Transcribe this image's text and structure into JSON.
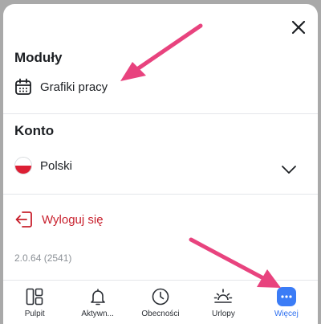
{
  "modules": {
    "title": "Moduły",
    "items": [
      {
        "label": "Grafiki pracy",
        "icon": "calendar-icon"
      }
    ]
  },
  "account": {
    "title": "Konto",
    "language": {
      "label": "Polski",
      "icon": "poland-flag-icon"
    }
  },
  "logout": {
    "label": "Wyloguj się",
    "icon": "logout-icon",
    "color": "#c8202d"
  },
  "version": "2.0.64 (2541)",
  "bottom_nav": {
    "items": [
      {
        "label": "Pulpit",
        "icon": "dashboard-icon",
        "active": false
      },
      {
        "label": "Aktywn...",
        "icon": "bell-icon",
        "active": false
      },
      {
        "label": "Obecności",
        "icon": "clock-icon",
        "active": false
      },
      {
        "label": "Urlopy",
        "icon": "sunrise-icon",
        "active": false
      },
      {
        "label": "Więcej",
        "icon": "more-icon",
        "active": true
      }
    ]
  },
  "colors": {
    "accent": "#3b7cf6",
    "arrow": "#e8437e",
    "danger": "#c8202d",
    "overlay": "#a9a9a9"
  }
}
